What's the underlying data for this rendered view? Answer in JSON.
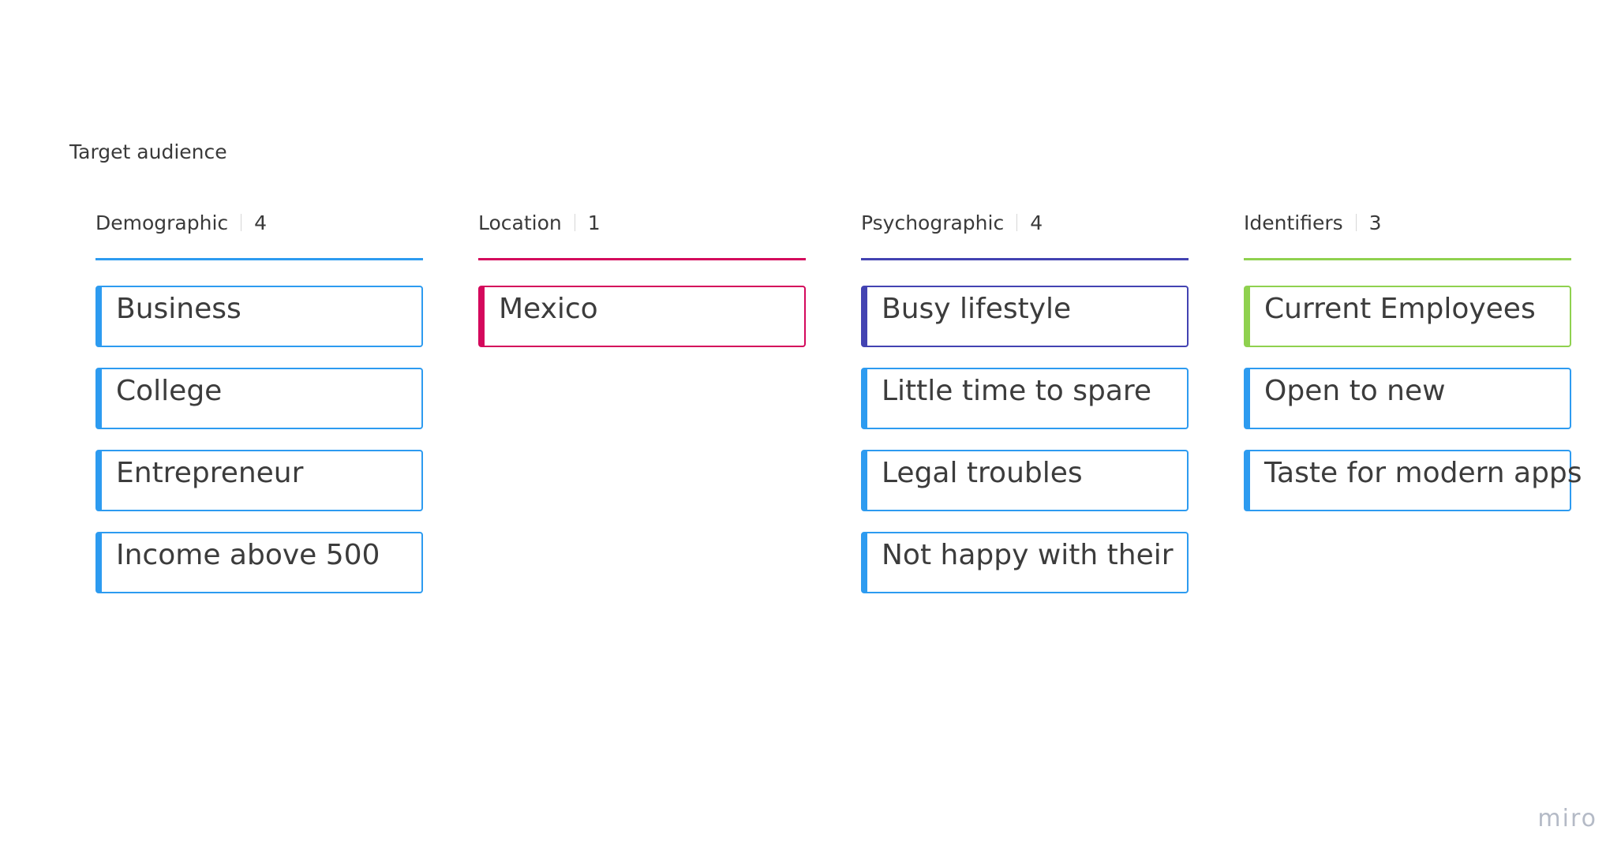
{
  "board": {
    "title": "Target audience",
    "watermark": "miro"
  },
  "columns": [
    {
      "name": "Demographic",
      "count": "4",
      "color": "#2d9bf0",
      "cards": [
        {
          "text": "Business",
          "color": "#2d9bf0"
        },
        {
          "text": "College",
          "color": "#2d9bf0"
        },
        {
          "text": "Entrepreneur",
          "color": "#2d9bf0"
        },
        {
          "text": "Income above 500",
          "color": "#2d9bf0"
        }
      ]
    },
    {
      "name": "Location",
      "count": "1",
      "color": "#d4095c",
      "cards": [
        {
          "text": "Mexico",
          "color": "#d4095c"
        }
      ]
    },
    {
      "name": "Psychographic",
      "count": "4",
      "color": "#4343b2",
      "cards": [
        {
          "text": "Busy lifestyle",
          "color": "#4343b2"
        },
        {
          "text": "Little time to spare",
          "color": "#2d9bf0"
        },
        {
          "text": "Legal troubles",
          "color": "#2d9bf0"
        },
        {
          "text": "Not happy with their",
          "color": "#2d9bf0"
        }
      ]
    },
    {
      "name": "Identifiers",
      "count": "3",
      "color": "#8fd14f",
      "cards": [
        {
          "text": "Current Employees",
          "color": "#8fd14f"
        },
        {
          "text": "Open to new",
          "color": "#2d9bf0"
        },
        {
          "text": "Taste for modern apps",
          "color": "#2d9bf0"
        }
      ]
    }
  ]
}
